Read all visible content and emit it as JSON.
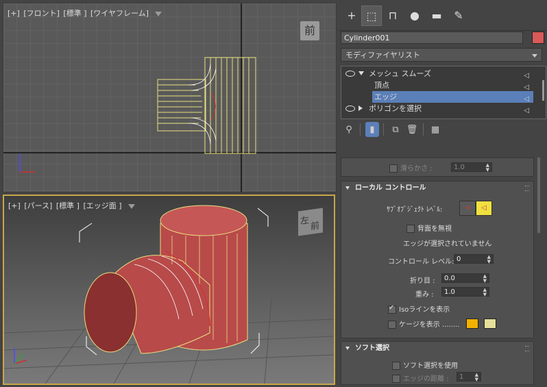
{
  "viewports": {
    "front": {
      "label_parts": [
        "[+]",
        "[フロント]",
        "[標準 ]",
        "[ワイヤフレーム]"
      ],
      "viewcube_label": "前"
    },
    "perspective": {
      "label_parts": [
        "[+]",
        "[パース]",
        "[標準 ]",
        "[エッジ面 ]"
      ],
      "viewcube_top": "左",
      "viewcube_front": "前"
    }
  },
  "command_panel": {
    "tabs": [
      "create-icon",
      "modify-icon",
      "hierarchy-icon",
      "motion-icon",
      "display-icon",
      "utilities-icon"
    ],
    "object_name": "Cylinder001",
    "object_color": "#d85a5a",
    "modifier_list_label": "モディファイヤリスト",
    "stack": [
      {
        "label": "メッシュ スムーズ",
        "kind": "modifier"
      },
      {
        "label": "頂点",
        "kind": "sub"
      },
      {
        "label": "エッジ",
        "kind": "sub",
        "selected": true
      },
      {
        "label": "ポリゴンを選択",
        "kind": "modifier"
      }
    ],
    "smoothness": {
      "label": "滑らかさ :",
      "value": "1.0"
    },
    "local_control": {
      "title": "ローカル コントロール",
      "subobject_level_label": "ｻﾌﾞｵﾌﾞｼﾞｪｸﾄ ﾚﾍﾞﾙ:",
      "ignore_backfacing": "背面を無視",
      "status": "エッジが選択されていません",
      "control_level_label": "コントロール レベル:",
      "control_level_value": "0",
      "crease_label": "折り目 :",
      "crease_value": "0.0",
      "weight_label": "重み :",
      "weight_value": "1.0",
      "iso_label": "Isoラインを表示",
      "iso_checked": true,
      "cage_label": "ケージを表示 ........",
      "cage_color_1": "#f2b100",
      "cage_color_2": "#e6df9a"
    },
    "soft_selection": {
      "title": "ソフト選択",
      "use_label": "ソフト選択を使用",
      "edge_distance_label": "エッジの距離 :",
      "edge_distance_value": "1"
    }
  }
}
